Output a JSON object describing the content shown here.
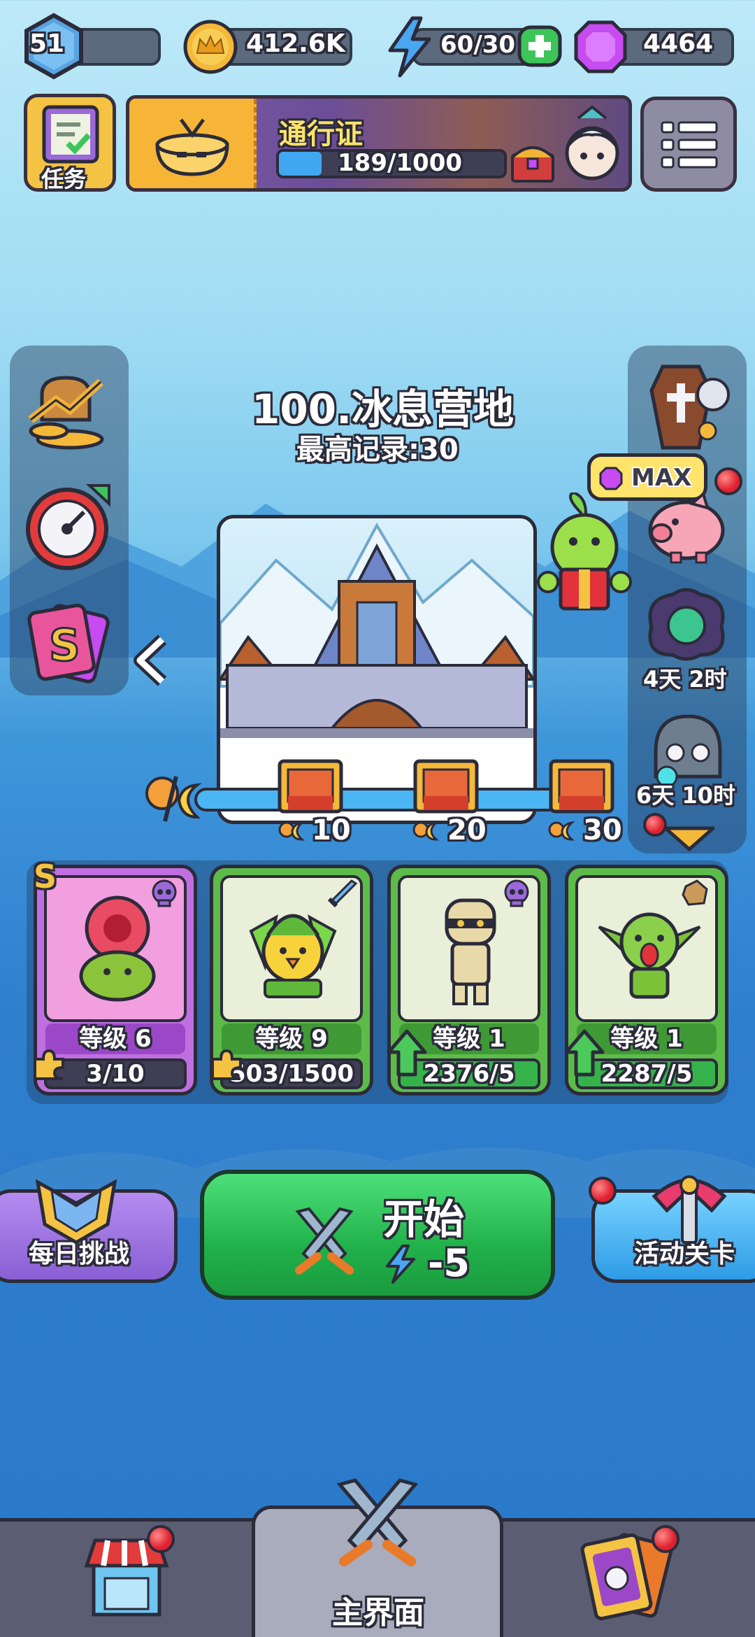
{
  "top_bar": {
    "player_level": "51",
    "coins": "412.6K",
    "energy": "60/30",
    "gems": "4464"
  },
  "banner": {
    "task_label": "任务",
    "pass_title": "通行证",
    "pass_progress_text": "189/1000",
    "pass_progress": 0.189
  },
  "stage": {
    "name": "100.冰息营地",
    "best_record": "最高记录:30",
    "milestones": [
      "10",
      "20",
      "30"
    ]
  },
  "right_panel": {
    "max_badge": "MAX",
    "event1_timer": "4天 2时",
    "event2_timer": "6天 10时"
  },
  "cards": [
    {
      "rank": "S",
      "level": "等级 6",
      "progress": "3/10",
      "bg": "#c06fe0",
      "inner": "#f29fe0",
      "tag": "skull-icon"
    },
    {
      "rank": "",
      "level": "等级 9",
      "progress": "503/1500",
      "bg": "#5dbb4a",
      "inner": "#e9efd8",
      "tag": "sword-icon"
    },
    {
      "rank": "",
      "level": "等级 1",
      "progress": "2376/5",
      "bg": "#5dbb4a",
      "inner": "#e9efd8",
      "tag": "skull-icon"
    },
    {
      "rank": "",
      "level": "等级 1",
      "progress": "2287/5",
      "bg": "#5dbb4a",
      "inner": "#e9efd8",
      "tag": "rock-icon"
    }
  ],
  "actions": {
    "daily_label": "每日挑战",
    "start_label": "开始",
    "start_cost": "-5",
    "event_label": "活动关卡"
  },
  "bottom_nav": {
    "home_label": "主界面"
  }
}
